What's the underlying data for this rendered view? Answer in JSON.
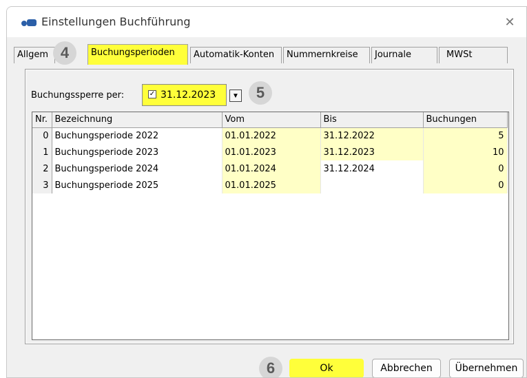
{
  "window": {
    "title": "Einstellungen Buchführung"
  },
  "tabs": [
    {
      "label": "Allgem"
    },
    {
      "label": "Buchungsperioden"
    },
    {
      "label": "Automatik-Konten"
    },
    {
      "label": "Nummernkreise"
    },
    {
      "label": "Journale"
    },
    {
      "label": "MWSt"
    }
  ],
  "annotations": {
    "step4": "4",
    "step5": "5",
    "step6": "6"
  },
  "lock": {
    "label": "Buchungssperre per:",
    "checked": "✓",
    "date": "31.12.2023"
  },
  "table": {
    "headers": [
      "Nr.",
      "Bezeichnung",
      "Vom",
      "Bis",
      "Buchungen"
    ],
    "rows": [
      {
        "nr": "0",
        "bez": "Buchungsperiode 2022",
        "vom": "01.01.2022",
        "bis": "31.12.2022",
        "buchungen": "5"
      },
      {
        "nr": "1",
        "bez": "Buchungsperiode 2023",
        "vom": "01.01.2023",
        "bis": "31.12.2023",
        "buchungen": "10"
      },
      {
        "nr": "2",
        "bez": "Buchungsperiode 2024",
        "vom": "01.01.2024",
        "bis": "31.12.2024",
        "buchungen": "0"
      },
      {
        "nr": "3",
        "bez": "Buchungsperiode 2025",
        "vom": "01.01.2025",
        "bis": "",
        "buchungen": "0"
      }
    ]
  },
  "buttons": {
    "ok": "Ok",
    "cancel": "Abbrechen",
    "apply": "Übernehmen"
  },
  "colors": {
    "highlight": "#ffff3a",
    "editable_cell": "#ffffc6",
    "badge": "#d6d6d6"
  }
}
